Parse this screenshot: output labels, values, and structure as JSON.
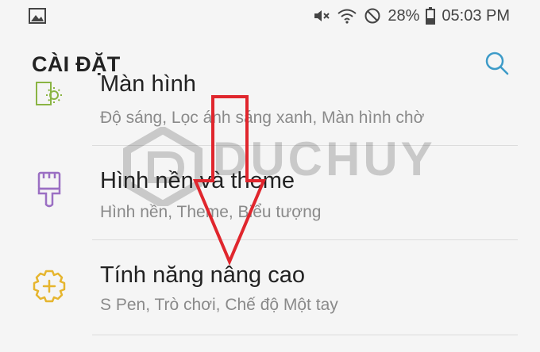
{
  "status_bar": {
    "battery": "28%",
    "time": "05:03 PM",
    "icons": [
      "gallery-notification-icon",
      "mute-icon",
      "wifi-icon",
      "do-not-disturb-icon",
      "battery-icon"
    ]
  },
  "app_bar": {
    "title": "CÀI ĐẶT"
  },
  "items": [
    {
      "title": "Màn hình",
      "subtitle": "Độ sáng, Lọc ánh sáng xanh, Màn hình chờ",
      "icon": "display-brightness-icon"
    },
    {
      "title": "Hình nền và theme",
      "subtitle": "Hình nền, Theme, Biểu tượng",
      "icon": "paint-brush-icon"
    },
    {
      "title": "Tính năng nâng cao",
      "subtitle": "S Pen, Trò chơi, Chế độ Một tay",
      "icon": "advanced-features-gear-plus-icon"
    }
  ],
  "watermark": {
    "text": "DUCHUY"
  },
  "colors": {
    "accent": "#3d9bc8",
    "arrow": "#e0262d",
    "display_icon": "#8ab443",
    "wallpaper_icon": "#9b6fc3",
    "advanced_icon": "#e6b52e"
  }
}
